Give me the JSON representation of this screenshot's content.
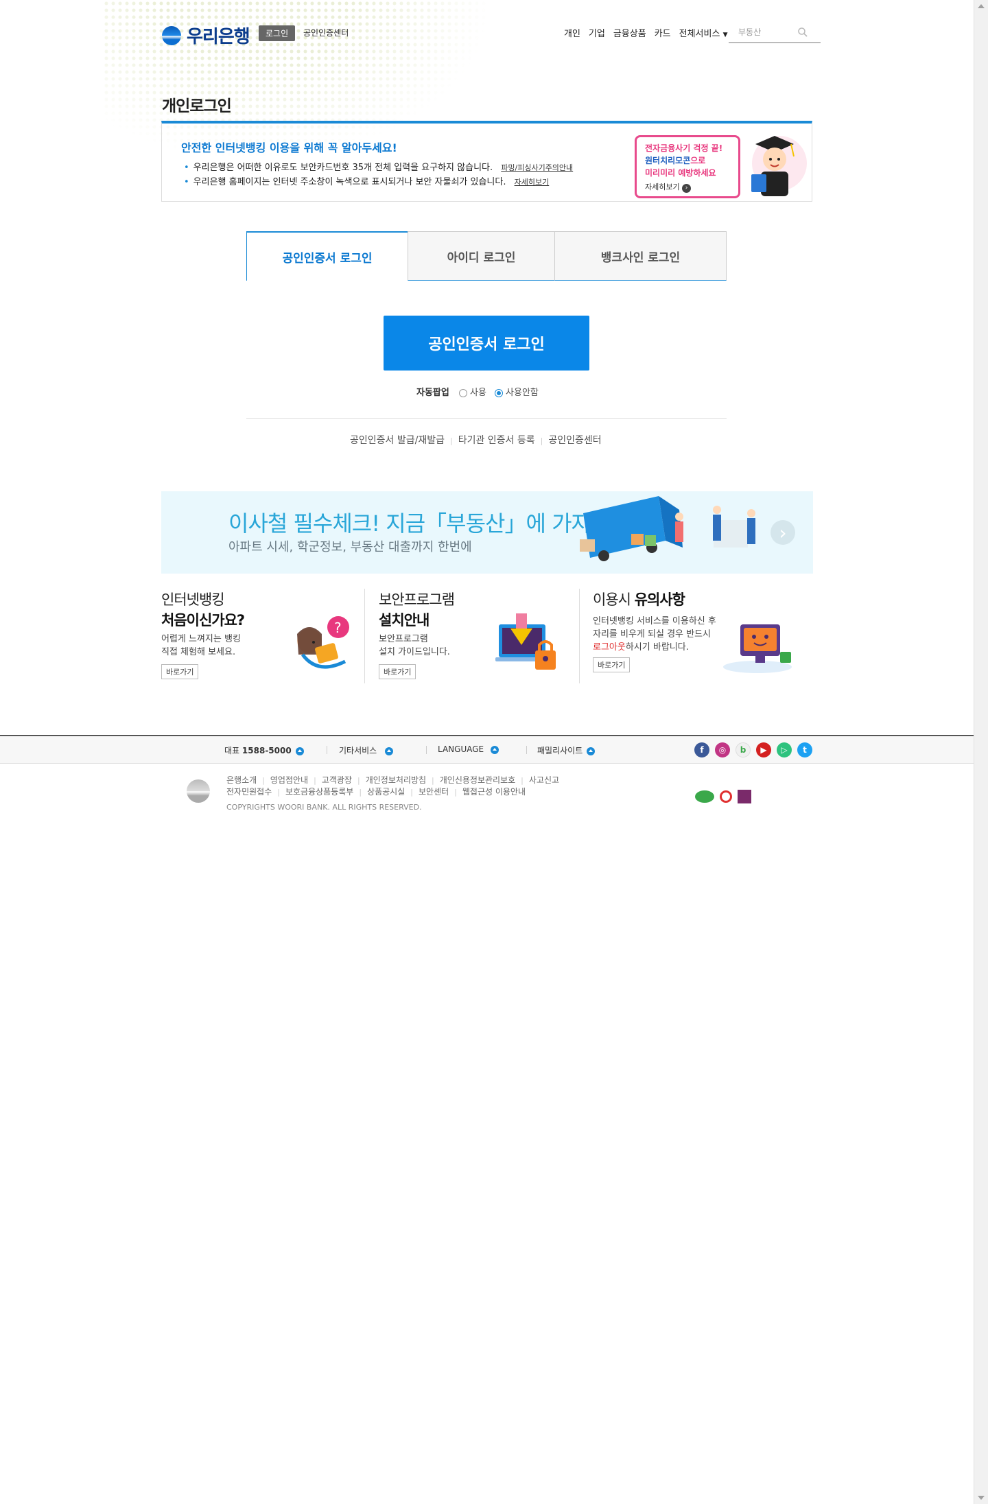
{
  "header": {
    "logo_text": "우리은행",
    "login_badge": "로그인",
    "cert_center": "공인인증센터",
    "nav": [
      "개인",
      "기업",
      "금융상품",
      "카드",
      "전체서비스"
    ],
    "search_placeholder": "부동산"
  },
  "page_title": "개인로그인",
  "notice": {
    "title": "안전한 인터넷뱅킹 이용을 위해 꼭 알아두세요!",
    "line1": "우리은행은 어떠한 이유로도 보안카드번호 35개 전체 입력을 요구하지 않습니다.",
    "line1_link": "파밍/피싱사기주의안내",
    "line2": "우리은행 홈페이지는 인터넷 주소창이 녹색으로 표시되거나 보안 자물쇠가 있습니다.",
    "line2_link": "자세히보기",
    "callout_line1": "전자금융사기 걱정 끝!",
    "callout_line2a": "원터치리모콘",
    "callout_line2b": "으로",
    "callout_line3": "미리미리 예방하세요",
    "callout_more": "자세히보기"
  },
  "tabs": [
    {
      "label": "공인인증서 로그인",
      "active": true
    },
    {
      "label": "아이디 로그인",
      "active": false
    },
    {
      "label": "뱅크사인 로그인",
      "active": false
    }
  ],
  "login_button": "공인인증서 로그인",
  "auto_popup": {
    "label": "자동팝업",
    "option_on": "사용",
    "option_off": "사용안함",
    "selected": "사용안함"
  },
  "cert_links": [
    "공인인증서 발급/재발급",
    "타기관 인증서 등록",
    "공인인증센터"
  ],
  "banner": {
    "title": "이사철 필수체크! 지금「부동산」에 가자",
    "subtitle": "아파트 시세, 학군정보, 부동산 대출까지 한번에"
  },
  "promos": [
    {
      "title1": "인터넷뱅킹",
      "title2": "처음이신가요?",
      "desc1": "어렵게 느껴지는 뱅킹",
      "desc2": "직접 체험해 보세요.",
      "button": "바로가기"
    },
    {
      "title1": "보안프로그램",
      "title2": "설치안내",
      "desc1": "보안프로그램",
      "desc2": "설치 가이드입니다.",
      "button": "바로가기"
    },
    {
      "title1": "이용시",
      "title2": "유의사항",
      "desc1": "인터넷뱅킹 서비스를 이용하신 후",
      "desc2": "자리를 비우게 되실 경우 반드시",
      "desc3_red": "로그아웃",
      "desc3_rest": "하시기 바랍니다.",
      "button": "바로가기"
    }
  ],
  "footer_bar": {
    "phone_label": "대표",
    "phone_number": "1588-5000",
    "other_services": "기타서비스",
    "language": "LANGUAGE",
    "family_sites": "패밀리사이트"
  },
  "footer": {
    "links_row1": [
      "은행소개",
      "영업점안내",
      "고객광장",
      "개인정보처리방침",
      "개인신용정보관리보호",
      "사고신고"
    ],
    "links_row2": [
      "전자민원접수",
      "보호금융상품등록부",
      "상품공시실",
      "보안센터",
      "웹접근성 이용안내"
    ],
    "copyright": "COPYRIGHTS WOORI BANK. ALL RIGHTS RESERVED."
  },
  "colors": {
    "brand_blue": "#0a87e8",
    "accent_pink": "#e84a8c"
  }
}
